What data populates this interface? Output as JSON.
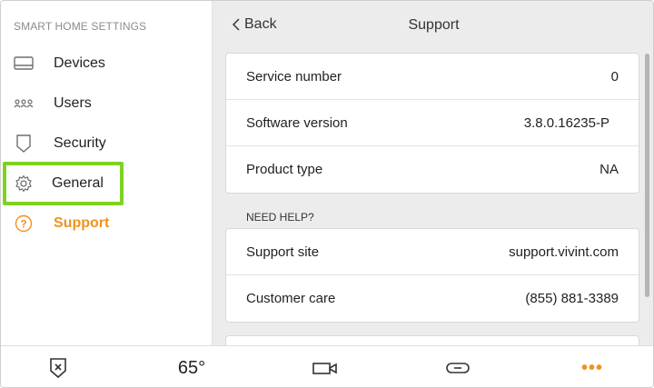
{
  "sidebar": {
    "heading": "SMART HOME SETTINGS",
    "items": [
      {
        "label": "Devices",
        "icon": "devices-icon"
      },
      {
        "label": "Users",
        "icon": "users-icon"
      },
      {
        "label": "Security",
        "icon": "shield-icon"
      },
      {
        "label": "General",
        "icon": "gear-icon"
      },
      {
        "label": "Support",
        "icon": "help-circle-icon"
      }
    ],
    "active_item": "Support",
    "highlighted_item": "General"
  },
  "header": {
    "back_label": "Back",
    "title": "Support"
  },
  "info_card": {
    "rows": [
      {
        "label": "Service number",
        "value": "0"
      },
      {
        "label": "Software version",
        "value": "3.8.0.16235-P"
      },
      {
        "label": "Product type",
        "value": "NA"
      }
    ]
  },
  "help_section": {
    "heading": "NEED HELP?",
    "rows": [
      {
        "label": "Support site",
        "value": "support.vivint.com"
      },
      {
        "label": "Customer care",
        "value": "(855) 881-3389"
      }
    ]
  },
  "bottom_bar": {
    "temperature": "65°",
    "more": "•••"
  },
  "colors": {
    "accent": "#f0921f",
    "highlight": "#7ed321",
    "panel_bg": "#ececec"
  }
}
